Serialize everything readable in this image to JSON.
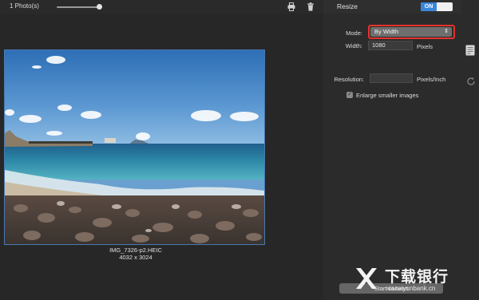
{
  "toolbar": {
    "photo_count": "1 Photo(s)",
    "icons": [
      "printer-icon",
      "trash-icon"
    ]
  },
  "photo": {
    "file_name": "IMG_7326-p2.HEIC",
    "dimensions": "4032 x 3024"
  },
  "resize_panel": {
    "title": "Resize",
    "toggle_label": "ON",
    "mode_label": "Mode:",
    "mode_value": "By Width",
    "width_label": "Width:",
    "width_value": "1080",
    "width_unit": "Pixels",
    "resolution_label": "Resolution:",
    "resolution_value": "",
    "resolution_unit": "Pixels/Inch",
    "enlarge_label": "Enlarge smaller images",
    "enlarge_checked": true,
    "convert_button": "Start convert"
  },
  "side_icons": [
    "settings-doc-icon",
    "refresh-icon"
  ],
  "watermark": {
    "text": "下载银行",
    "url": "xiazaiyunbank.cn"
  },
  "colors": {
    "accent": "#3a86d9",
    "highlight": "#e5322d",
    "background": "#262626"
  }
}
